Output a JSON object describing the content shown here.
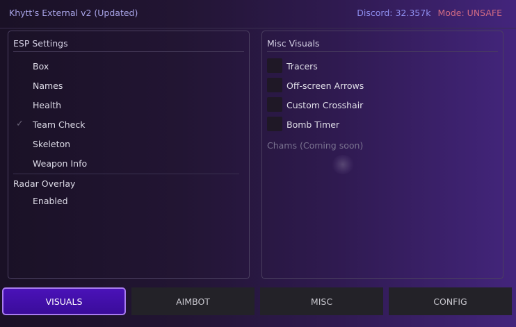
{
  "header": {
    "title": "Khytt's External v2 (Updated)",
    "discord": "Discord: 32.357k",
    "mode": "Mode: UNSAFE"
  },
  "esp": {
    "title": "ESP Settings",
    "items": [
      {
        "label": "Box",
        "checked": false
      },
      {
        "label": "Names",
        "checked": false
      },
      {
        "label": "Health",
        "checked": false
      },
      {
        "label": "Team Check",
        "checked": true
      },
      {
        "label": "Skeleton",
        "checked": false
      },
      {
        "label": "Weapon Info",
        "checked": false
      }
    ],
    "radar": {
      "title": "Radar Overlay",
      "items": [
        {
          "label": "Enabled",
          "checked": false
        }
      ]
    }
  },
  "misc_visuals": {
    "title": "Misc Visuals",
    "items": [
      {
        "label": "Tracers"
      },
      {
        "label": "Off-screen Arrows"
      },
      {
        "label": "Custom Crosshair"
      },
      {
        "label": "Bomb Timer"
      }
    ],
    "chams_label": "Chams (Coming soon)"
  },
  "tabs": [
    {
      "label": "VISUALS",
      "active": true
    },
    {
      "label": "AIMBOT",
      "active": false
    },
    {
      "label": "MISC",
      "active": false
    },
    {
      "label": "CONFIG",
      "active": false
    }
  ],
  "colors": {
    "accent": "#4a12b8",
    "accent_border": "#a97cf0",
    "title_text": "#a7a3e6",
    "discord_text": "#8f8ff0",
    "mode_text": "#d06a83"
  }
}
